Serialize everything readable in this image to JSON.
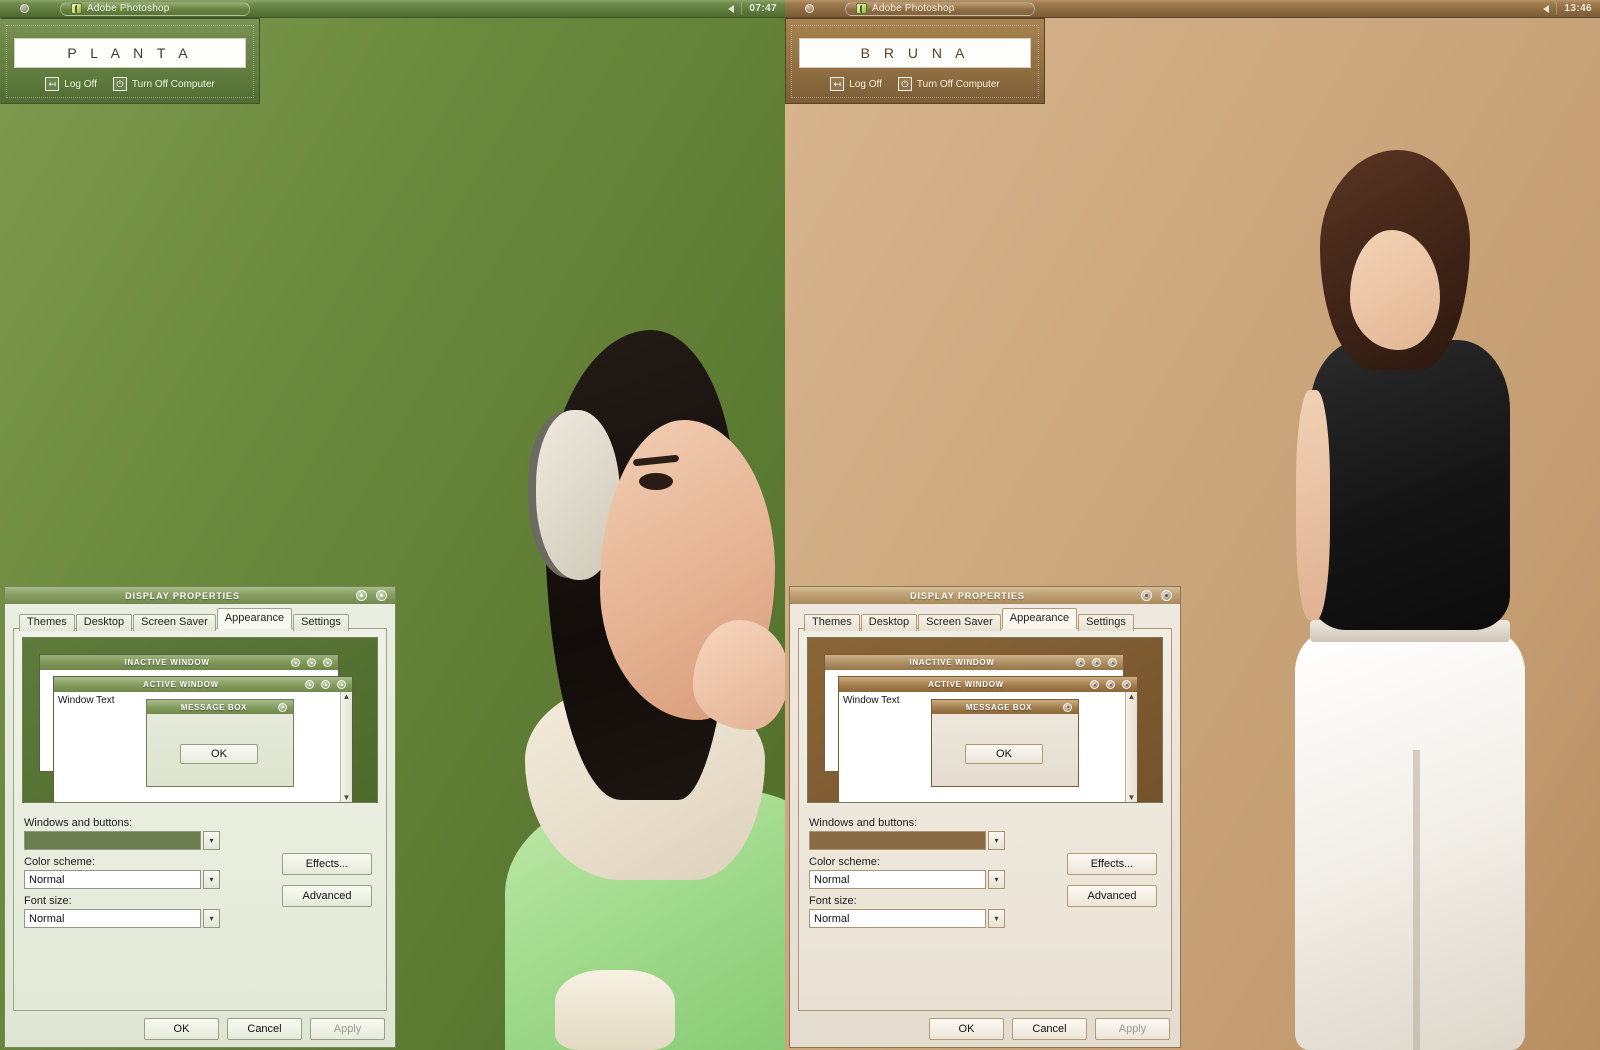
{
  "screens": [
    {
      "id": "green",
      "theme_name": "planta-green",
      "wallpaper_color": "#6B8940",
      "accent_color": "#6B7F4E",
      "taskbar": {
        "start_icon": "windows-orb-icon",
        "task_button_label": "Adobe Photoshop",
        "task_button_icon": "photoshop-icon",
        "tray_volume_icon": "volume-icon",
        "clock": "07:47"
      },
      "start_menu": {
        "user_name": "P L A N T A",
        "log_off_label": "Log Off",
        "log_off_icon": "log-off-icon",
        "turn_off_label": "Turn Off Computer",
        "turn_off_icon": "power-icon"
      },
      "dialog": {
        "title": "DISPLAY PROPERTIES",
        "titlebar_buttons": [
          "help-button",
          "close-button"
        ],
        "tabs": [
          {
            "label": "Themes",
            "active": false
          },
          {
            "label": "Desktop",
            "active": false
          },
          {
            "label": "Screen Saver",
            "active": false
          },
          {
            "label": "Appearance",
            "active": true
          },
          {
            "label": "Settings",
            "active": false
          }
        ],
        "preview": {
          "inactive_window_title": "INACTIVE WINDOW",
          "active_window_title": "ACTIVE WINDOW",
          "window_text": "Window Text",
          "message_box_title": "MESSAGE BOX",
          "message_box_ok": "OK",
          "scroll_up_icon": "chevron-up-icon",
          "scroll_down_icon": "chevron-down-icon"
        },
        "fields": [
          {
            "label": "Windows and buttons:",
            "value": "",
            "is_swatch": true
          },
          {
            "label": "Color scheme:",
            "value": "Normal",
            "is_swatch": false
          },
          {
            "label": "Font size:",
            "value": "Normal",
            "is_swatch": false
          }
        ],
        "side_buttons": [
          {
            "label": "Effects...",
            "disabled": false
          },
          {
            "label": "Advanced",
            "disabled": false
          }
        ],
        "footer_buttons": [
          {
            "label": "OK",
            "disabled": false
          },
          {
            "label": "Cancel",
            "disabled": false
          },
          {
            "label": "Apply",
            "disabled": true
          }
        ]
      }
    },
    {
      "id": "brown",
      "theme_name": "bruna-brown",
      "wallpaper_color": "#CDA87E",
      "accent_color": "#8A6A43",
      "taskbar": {
        "start_icon": "windows-orb-icon",
        "task_button_label": "Adobe Photoshop",
        "task_button_icon": "photoshop-icon",
        "tray_volume_icon": "volume-icon",
        "clock": "13:46"
      },
      "start_menu": {
        "user_name": "B R U N A",
        "log_off_label": "Log Off",
        "log_off_icon": "log-off-icon",
        "turn_off_label": "Turn Off Computer",
        "turn_off_icon": "power-icon"
      },
      "dialog": {
        "title": "DISPLAY PROPERTIES",
        "titlebar_buttons": [
          "help-button",
          "close-button"
        ],
        "tabs": [
          {
            "label": "Themes",
            "active": false
          },
          {
            "label": "Desktop",
            "active": false
          },
          {
            "label": "Screen Saver",
            "active": false
          },
          {
            "label": "Appearance",
            "active": true
          },
          {
            "label": "Settings",
            "active": false
          }
        ],
        "preview": {
          "inactive_window_title": "INACTIVE WINDOW",
          "active_window_title": "ACTIVE WINDOW",
          "window_text": "Window Text",
          "message_box_title": "MESSAGE BOX",
          "message_box_ok": "OK",
          "scroll_up_icon": "chevron-up-icon",
          "scroll_down_icon": "chevron-down-icon"
        },
        "fields": [
          {
            "label": "Windows and buttons:",
            "value": "",
            "is_swatch": true
          },
          {
            "label": "Color scheme:",
            "value": "Normal",
            "is_swatch": false
          },
          {
            "label": "Font size:",
            "value": "Normal",
            "is_swatch": false
          }
        ],
        "side_buttons": [
          {
            "label": "Effects...",
            "disabled": false
          },
          {
            "label": "Advanced",
            "disabled": false
          }
        ],
        "footer_buttons": [
          {
            "label": "OK",
            "disabled": false
          },
          {
            "label": "Cancel",
            "disabled": false
          },
          {
            "label": "Apply",
            "disabled": true
          }
        ]
      }
    }
  ]
}
